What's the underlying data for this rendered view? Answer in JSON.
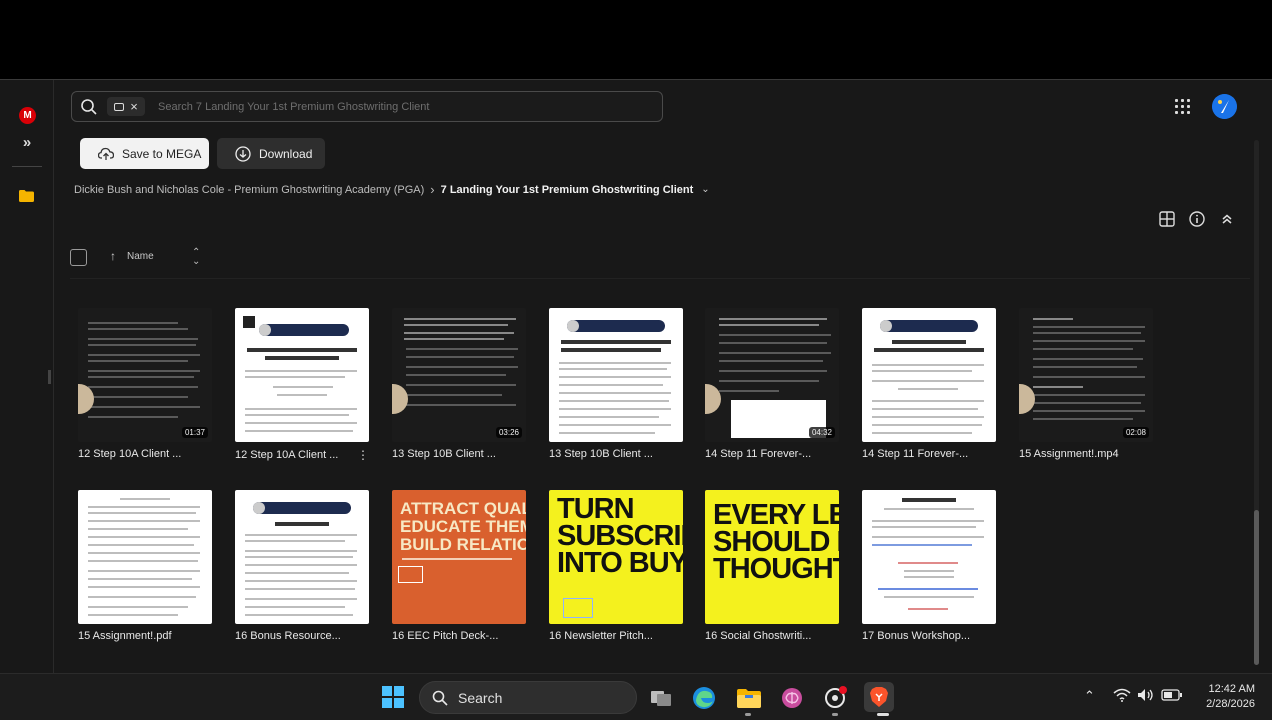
{
  "search": {
    "placeholder": "Search 7 Landing Your 1st Premium Ghostwriting Client"
  },
  "toolbar": {
    "save_label": "Save to MEGA",
    "download_label": "Download"
  },
  "breadcrumb": {
    "parent": "Dickie Bush and Nicholas Cole - Premium Ghostwriting Academy (PGA)",
    "current": "7 Landing Your 1st Premium Ghostwriting Client"
  },
  "list_header": {
    "name_label": "Name"
  },
  "files": [
    {
      "name": "12 Step 10A Client ...",
      "duration": "01:37"
    },
    {
      "name": "12 Step 10A Client ...",
      "duration": ""
    },
    {
      "name": "13 Step 10B Client ...",
      "duration": "03:26"
    },
    {
      "name": "13 Step 10B Client ...",
      "duration": ""
    },
    {
      "name": "14 Step 11 Forever-...",
      "duration": "04:32"
    },
    {
      "name": "14 Step 11 Forever-...",
      "duration": ""
    },
    {
      "name": "15 Assignment!.mp4",
      "duration": "02:08"
    },
    {
      "name": "15 Assignment!.pdf",
      "duration": ""
    },
    {
      "name": "16 Bonus Resource...",
      "duration": ""
    },
    {
      "name": "16 EEC Pitch Deck-...",
      "duration": ""
    },
    {
      "name": "16 Newsletter Pitch...",
      "duration": ""
    },
    {
      "name": "16 Social Ghostwriti...",
      "duration": ""
    },
    {
      "name": "17 Bonus Workshop...",
      "duration": ""
    }
  ],
  "thumb_text": {
    "eec_headline": "ATTRACT QUALITY CUS\nEDUCATE THEM ON AU\nBUILD RELATIONSHIPS",
    "newsletter_headline": "TURN\nSUBSCRIBE\nINTO BUYE",
    "social_headline": "EVERY LEAD\nSHOULD BE\nTHOUGHT LE"
  },
  "taskbar": {
    "search_label": "Search",
    "time": "12:42 AM",
    "date": "2/28/2026"
  },
  "colors": {
    "mega_red": "#d90007",
    "eec_orange": "#d9602e",
    "yellow": "#f4f11e",
    "windows_blue": "#4cc2ff"
  }
}
